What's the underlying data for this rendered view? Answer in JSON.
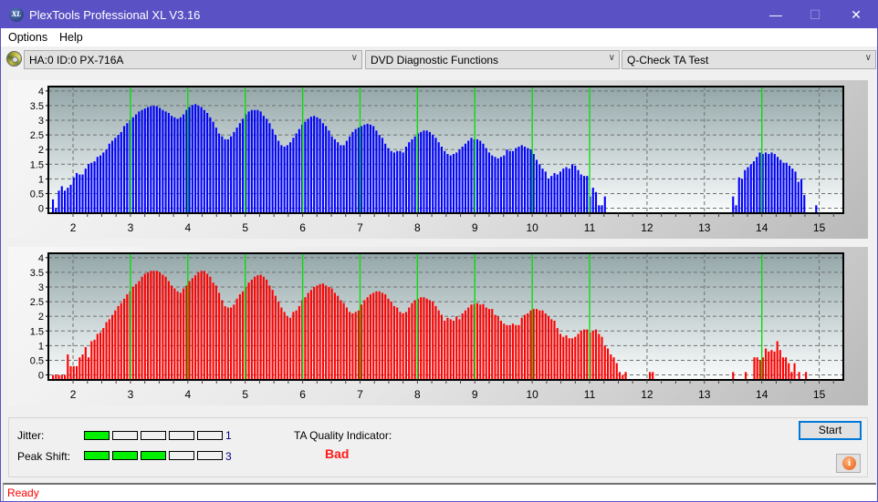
{
  "window": {
    "title": "PlexTools Professional XL V3.16",
    "logo_text": "XL",
    "controls": {
      "minimize": "—",
      "maximize": "☐",
      "close": "✕"
    }
  },
  "menu": {
    "items": [
      "Options",
      "Help"
    ]
  },
  "toolbar": {
    "drive_select": "HA:0 ID:0  PX-716A",
    "function_select": "DVD Diagnostic Functions",
    "test_select": "Q-Check TA Test",
    "chevron": "∨"
  },
  "chart_data": [
    {
      "type": "bar",
      "name": "TA test - upper (lands/pits) distribution",
      "color": "#0000ff",
      "xlim": [
        1.57,
        15.42
      ],
      "ylim": [
        -0.17,
        4.15
      ],
      "x_ticks": [
        2,
        3,
        4,
        5,
        6,
        7,
        8,
        9,
        10,
        11,
        12,
        13,
        14,
        15
      ],
      "y_ticks": [
        0,
        0.5,
        1,
        1.5,
        2,
        2.5,
        3,
        3.5,
        4
      ],
      "y_tick_labels": [
        "0",
        "0.5",
        "1",
        "1.5",
        "2",
        "2.5",
        "3",
        "3.5",
        "4"
      ],
      "green_markers": [
        3,
        4,
        5,
        6,
        7,
        8,
        9,
        10,
        11,
        14
      ],
      "grid": true,
      "x_start": 1.65,
      "x_step": 0.0517,
      "values": [
        0.3,
        0.0,
        0.6,
        0.75,
        0.6,
        0.7,
        0.8,
        1.05,
        1.2,
        1.15,
        1.15,
        1.35,
        1.5,
        1.55,
        1.6,
        1.75,
        1.8,
        1.9,
        2.0,
        2.2,
        2.3,
        2.4,
        2.5,
        2.6,
        2.8,
        2.9,
        3.0,
        3.1,
        3.2,
        3.3,
        3.35,
        3.4,
        3.45,
        3.48,
        3.5,
        3.48,
        3.42,
        3.35,
        3.3,
        3.25,
        3.15,
        3.1,
        3.05,
        3.1,
        3.2,
        3.35,
        3.45,
        3.52,
        3.55,
        3.5,
        3.45,
        3.35,
        3.25,
        3.1,
        2.95,
        2.75,
        2.55,
        2.45,
        2.35,
        2.35,
        2.45,
        2.6,
        2.75,
        2.9,
        3.05,
        3.2,
        3.3,
        3.35,
        3.35,
        3.35,
        3.3,
        3.15,
        3.05,
        2.9,
        2.7,
        2.5,
        2.3,
        2.15,
        2.1,
        2.15,
        2.25,
        2.4,
        2.55,
        2.7,
        2.85,
        2.95,
        3.05,
        3.12,
        3.15,
        3.1,
        3.05,
        2.9,
        2.8,
        2.65,
        2.45,
        2.35,
        2.25,
        2.15,
        2.15,
        2.3,
        2.45,
        2.6,
        2.7,
        2.75,
        2.8,
        2.85,
        2.88,
        2.85,
        2.8,
        2.65,
        2.5,
        2.4,
        2.2,
        2.05,
        1.95,
        1.9,
        1.95,
        1.95,
        1.9,
        2.1,
        2.25,
        2.35,
        2.45,
        2.55,
        2.6,
        2.65,
        2.65,
        2.6,
        2.5,
        2.4,
        2.25,
        2.1,
        1.95,
        1.85,
        1.8,
        1.85,
        1.9,
        2.0,
        2.1,
        2.2,
        2.3,
        2.4,
        2.35,
        2.35,
        2.3,
        2.2,
        2.05,
        1.9,
        1.8,
        1.75,
        1.7,
        1.75,
        1.8,
        2.0,
        1.95,
        1.95,
        2.05,
        2.1,
        2.15,
        2.1,
        2.05,
        2.0,
        1.85,
        1.65,
        1.5,
        1.35,
        1.25,
        1.0,
        1.1,
        1.2,
        1.15,
        1.25,
        1.35,
        1.4,
        1.35,
        1.5,
        1.45,
        1.3,
        1.15,
        1.1,
        1.1,
        0.4,
        0.7,
        0.55,
        0.1,
        0.1,
        0.4
      ],
      "cluster2_x_start": 13.5,
      "cluster2_values": [
        0.4,
        0.1,
        1.05,
        1.0,
        1.3,
        1.4,
        1.5,
        1.6,
        1.75,
        1.9,
        1.85,
        1.9,
        1.85,
        1.9,
        1.85,
        1.75,
        1.65,
        1.55,
        1.55,
        1.45,
        1.35,
        1.25,
        0.9,
        1.0,
        0.45,
        0.0,
        0.0,
        0.0,
        0.1
      ]
    },
    {
      "type": "bar",
      "name": "TA test - lower (lands/pits) distribution",
      "color": "#ff0000",
      "xlim": [
        1.57,
        15.42
      ],
      "ylim": [
        -0.17,
        4.15
      ],
      "x_ticks": [
        2,
        3,
        4,
        5,
        6,
        7,
        8,
        9,
        10,
        11,
        12,
        13,
        14,
        15
      ],
      "y_ticks": [
        0,
        0.5,
        1,
        1.5,
        2,
        2.5,
        3,
        3.5,
        4
      ],
      "y_tick_labels": [
        "0",
        "0.5",
        "1",
        "1.5",
        "2",
        "2.5",
        "3",
        "3.5",
        "4"
      ],
      "green_markers": [
        3,
        4,
        5,
        6,
        7,
        8,
        9,
        10,
        11,
        14
      ],
      "grid": true,
      "x_start": 1.65,
      "x_step": 0.0517,
      "values": [
        0.0,
        0.0,
        0.0,
        0.0,
        0.0,
        0.7,
        0.3,
        0.3,
        0.3,
        0.6,
        0.7,
        0.95,
        0.6,
        1.15,
        1.2,
        1.4,
        1.45,
        1.6,
        1.8,
        1.9,
        2.05,
        2.2,
        2.35,
        2.45,
        2.6,
        2.75,
        2.85,
        3.0,
        3.1,
        3.2,
        3.35,
        3.45,
        3.5,
        3.55,
        3.55,
        3.55,
        3.5,
        3.42,
        3.35,
        3.2,
        3.05,
        2.95,
        2.85,
        2.8,
        2.95,
        3.05,
        3.2,
        3.3,
        3.4,
        3.5,
        3.55,
        3.55,
        3.45,
        3.35,
        3.15,
        3.05,
        2.8,
        2.55,
        2.35,
        2.3,
        2.3,
        2.4,
        2.6,
        2.75,
        2.85,
        3.0,
        3.15,
        3.25,
        3.35,
        3.4,
        3.42,
        3.35,
        3.25,
        3.05,
        2.9,
        2.7,
        2.5,
        2.3,
        2.15,
        2.0,
        1.95,
        2.15,
        2.2,
        2.35,
        2.55,
        2.65,
        2.8,
        2.9,
        3.0,
        3.05,
        3.1,
        3.12,
        3.05,
        3.0,
        2.95,
        2.8,
        2.7,
        2.55,
        2.45,
        2.3,
        2.15,
        2.1,
        2.15,
        2.2,
        2.4,
        2.55,
        2.65,
        2.75,
        2.8,
        2.85,
        2.85,
        2.8,
        2.75,
        2.6,
        2.5,
        2.35,
        2.3,
        2.15,
        2.1,
        2.15,
        2.3,
        2.45,
        2.55,
        2.6,
        2.65,
        2.65,
        2.6,
        2.55,
        2.5,
        2.35,
        2.2,
        2.05,
        1.85,
        1.95,
        1.9,
        1.85,
        2.0,
        1.9,
        2.1,
        2.2,
        2.3,
        2.4,
        2.42,
        2.45,
        2.4,
        2.42,
        2.3,
        2.25,
        2.25,
        2.05,
        2.0,
        1.85,
        1.75,
        1.7,
        1.7,
        1.75,
        1.7,
        1.7,
        1.95,
        2.05,
        2.1,
        2.2,
        2.25,
        2.25,
        2.2,
        2.2,
        2.1,
        2.0,
        1.9,
        1.85,
        1.6,
        1.4,
        1.3,
        1.35,
        1.25,
        1.25,
        1.3,
        1.4,
        1.5,
        1.55,
        1.55,
        1.45,
        1.5,
        1.55,
        1.4,
        1.3,
        1.0,
        0.9,
        0.7,
        0.6,
        0.4,
        0.1,
        0.0,
        0.1
      ],
      "sparse_x": [
        12.05,
        12.1,
        13.5,
        13.72,
        13.87,
        13.92,
        13.97,
        14.02,
        14.07,
        14.12,
        14.17,
        14.22,
        14.27,
        14.32,
        14.37,
        14.42,
        14.47,
        14.52,
        14.57,
        14.65,
        14.77
      ],
      "sparse_values": [
        0.1,
        0.1,
        0.1,
        0.1,
        0.6,
        0.6,
        0.5,
        0.6,
        0.9,
        0.8,
        0.85,
        0.8,
        1.15,
        0.85,
        0.6,
        0.6,
        0.4,
        0.1,
        0.4,
        0.1,
        0.1
      ]
    }
  ],
  "results": {
    "jitter_label": "Jitter:",
    "jitter_value": "1",
    "jitter_level": 1,
    "peak_shift_label": "Peak Shift:",
    "peak_shift_value": "3",
    "peak_shift_level": 3,
    "meter_segments": 5,
    "ta_quality_label": "TA Quality Indicator:",
    "ta_quality_value": "Bad"
  },
  "buttons": {
    "start": "Start",
    "info": "i"
  },
  "status": {
    "text": "Ready"
  },
  "colors": {
    "accent": "#5a52c4",
    "marker": "#00e000",
    "meter_on": "#00f000",
    "bad": "#ff1a1a"
  }
}
